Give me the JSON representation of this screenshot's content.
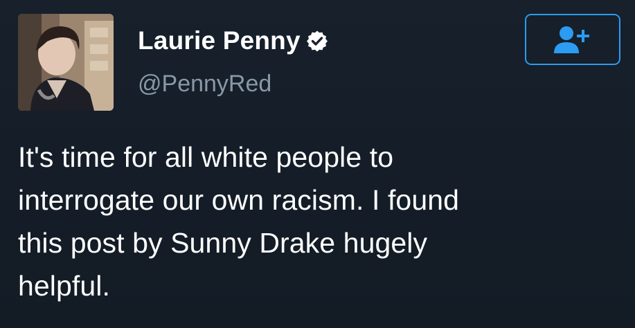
{
  "tweet": {
    "author": {
      "display_name": "Laurie Penny",
      "handle": "@PennyRed",
      "verified": true,
      "avatar_icon": "profile-photo"
    },
    "follow_button": {
      "icon": "add-user-icon"
    },
    "text": "It's time for all white people to\ninterrogate our own racism. I found\nthis post by Sunny Drake hugely\nhelpful."
  },
  "colors": {
    "background": "#141c26",
    "accent": "#2b9cf2",
    "handle": "#8899a6",
    "text": "#ffffff"
  }
}
